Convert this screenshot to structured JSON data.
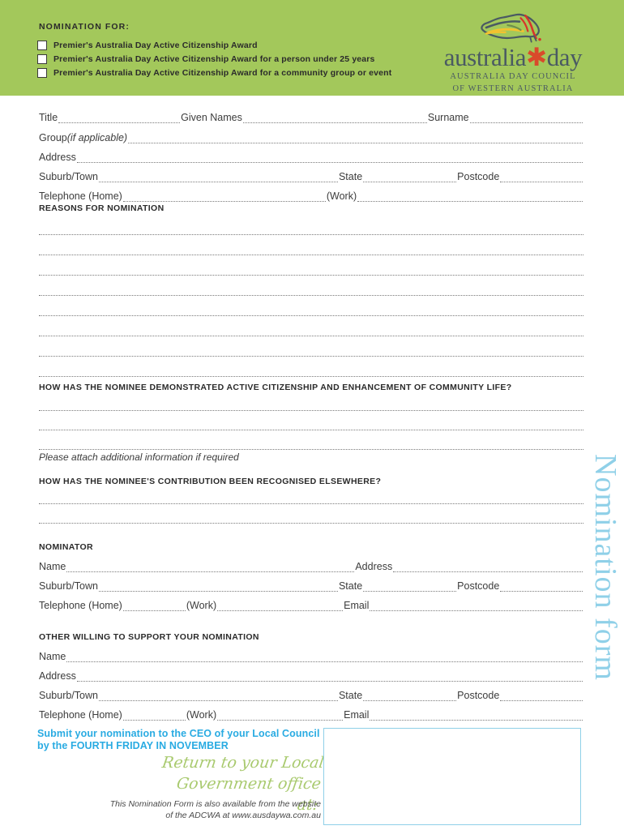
{
  "header": {
    "title": "NOMINATION FOR:",
    "background_color": "#a3c85b",
    "checkboxes": [
      {
        "label": "Premier's Australia Day Active Citizenship Award",
        "checked": false
      },
      {
        "label": "Premier's Australia Day Active Citizenship Award for a person under 25 years",
        "checked": false
      },
      {
        "label": "Premier's Australia Day Active Citizenship Award for a community group or event",
        "checked": false
      }
    ]
  },
  "logo": {
    "wordmark": "australia",
    "wordmark_2": "day",
    "line1": "AUSTRALIA DAY COUNCIL",
    "line2": "OF WESTERN AUSTRALIA",
    "map_colors": {
      "outline": "#4a5a63",
      "red": "#d8332a",
      "yellow": "#f2c230",
      "green": "#6f8f4a"
    },
    "text_color": "#4a5a63"
  },
  "nominee": {
    "row_title": {
      "label1": "Title",
      "label2": "Given Names",
      "label3": "Surname"
    },
    "row_group": {
      "label": "Group ",
      "label_italic": "(if applicable)"
    },
    "row_address": {
      "label": "Address"
    },
    "row_suburb": {
      "label1": "Suburb/Town",
      "label2": "State",
      "label3": "Postcode"
    },
    "row_phone": {
      "label1": "Telephone (Home)",
      "label2": "(Work)"
    }
  },
  "sections": {
    "reasons_heading": "REASONS FOR NOMINATION",
    "reasons_line_count": 8,
    "active_citizenship_heading": "HOW HAS THE NOMINEE DEMONSTRATED ACTIVE CITIZENSHIP AND ENHANCEMENT OF COMMUNITY LIFE?",
    "active_citizenship_line_count": 3,
    "attach_note": "Please attach additional information if required",
    "recognised_heading": "HOW HAS THE NOMINEE'S CONTRIBUTION BEEN RECOGNISED ELSEWHERE?",
    "recognised_line_count": 2,
    "nominator_heading": "NOMINATOR",
    "supporter_heading": "OTHER WILLING TO SUPPORT YOUR NOMINATION"
  },
  "nominator": {
    "row_name": {
      "label1": "Name",
      "label2": "Address"
    },
    "row_suburb": {
      "label1": "Suburb/Town",
      "label2": "State",
      "label3": "Postcode"
    },
    "row_phone": {
      "label1": "Telephone (Home)",
      "label2": "(Work)",
      "label3": "Email"
    }
  },
  "supporter": {
    "row_name": {
      "label": "Name"
    },
    "row_address": {
      "label": "Address"
    },
    "row_suburb": {
      "label1": "Suburb/Town",
      "label2": "State",
      "label3": "Postcode"
    },
    "row_phone": {
      "label1": "Telephone (Home)",
      "label2": "(Work)",
      "label3": "Email"
    }
  },
  "side_title": {
    "text": "Nomination form",
    "color": "#8fd0e8"
  },
  "footer": {
    "submit_line1": "Submit your nomination to the CEO of your Local Council",
    "submit_line2": "by the FOURTH FRIDAY IN NOVEMBER",
    "submit_color": "#29abe2",
    "script_line1": "Return to your Local",
    "script_line2": "Government office at:",
    "script_color": "#a9ca6f",
    "note_line1": "This Nomination Form is also available from the website",
    "note_line2": "of the ADCWA at www.ausdaywa.com.au",
    "box_border_color": "#8fd0e8"
  }
}
